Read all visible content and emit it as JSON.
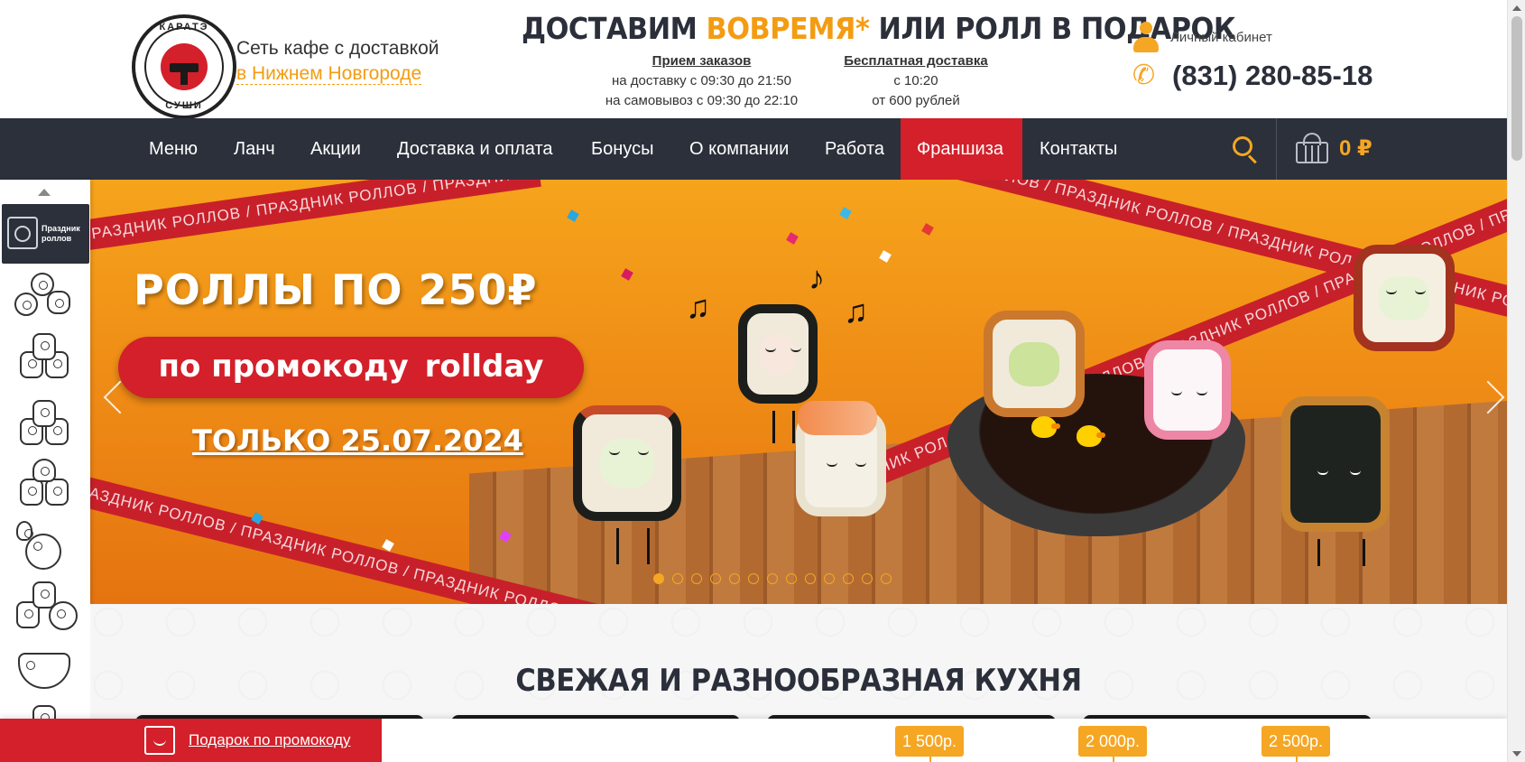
{
  "header": {
    "logo": {
      "top_text": "КАРАТЭ",
      "bottom_text": "СУШИ"
    },
    "tagline_line1": "Сеть кафе с доставкой",
    "tagline_city": "в Нижнем Новгороде",
    "promo": {
      "part1": "ДОСТАВИМ ",
      "highlight": "ВОВРЕМЯ*",
      "part2": " ИЛИ РОЛЛ В ПОДАРОК"
    },
    "orders": {
      "title": "Прием заказов",
      "line1": "на доставку с 09:30 до 21:50",
      "line2": "на самовывоз с 09:30 до 22:10"
    },
    "free_delivery": {
      "title": "Бесплатная доставка",
      "line1": "с 10:20",
      "line2": "от 600 рублей"
    },
    "account_label": "Личный кабинет",
    "phone": "(831) 280-85-18"
  },
  "nav": {
    "items": [
      "Меню",
      "Ланч",
      "Акции",
      "Доставка и оплата",
      "Бонусы",
      "О компании",
      "Работа",
      "Франшиза",
      "Контакты"
    ],
    "active_index": 7,
    "cart_total": "0 ₽"
  },
  "categories": {
    "active_label": "Праздник роллов",
    "items": [
      "rolls-icon",
      "rolls-stack-icon",
      "baked-rolls-icon",
      "gunkan-icon",
      "spicy-rolls-icon",
      "sets-icon",
      "wok-icon",
      "more-icon"
    ]
  },
  "banner": {
    "title": "РОЛЛЫ ПО 250₽",
    "promo_prefix": "по промокоду",
    "promo_code": "rollday",
    "date": "ТОЛЬКО 25.07.2024",
    "ribbon_text": "ПРАЗДНИК РОЛЛОВ / ПРАЗДНИК РОЛЛОВ / ПРАЗДНИК РОЛЛОВ / ПРАЗДНИК РОЛЛОВ / ПРАЗДНИК РОЛЛОВ /",
    "slide_count": 13,
    "active_slide": 0
  },
  "section": {
    "title": "СВЕЖАЯ И РАЗНООБРАЗНАЯ КУХНЯ"
  },
  "bottom_bar": {
    "gift_label": "Подарок по промокоду",
    "tiers": [
      "1 500р.",
      "2 000р.",
      "2 500р."
    ]
  },
  "colors": {
    "accent": "#f5a623",
    "brand_red": "#d3202a",
    "nav_bg": "#2b303b"
  }
}
